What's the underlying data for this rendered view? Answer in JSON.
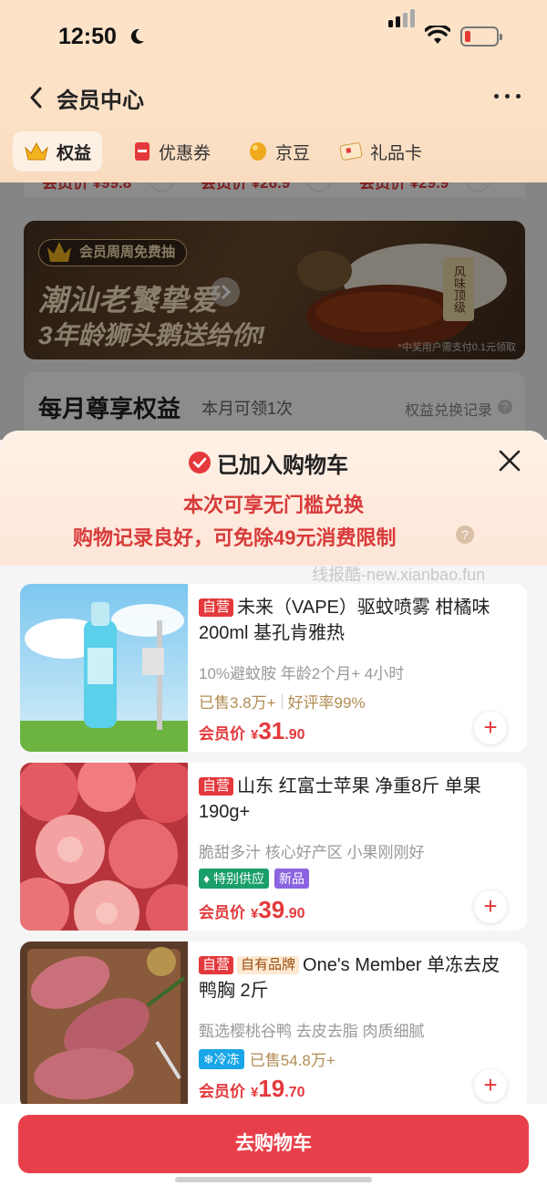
{
  "status": {
    "time": "12:50"
  },
  "nav": {
    "title": "会员中心"
  },
  "tabs": [
    {
      "label": "权益",
      "icon": "crown-icon",
      "active": true
    },
    {
      "label": "优惠券",
      "icon": "coupon-icon",
      "active": false
    },
    {
      "label": "京豆",
      "icon": "bean-icon",
      "active": false
    },
    {
      "label": "礼品卡",
      "icon": "gift-card-icon",
      "active": false
    }
  ],
  "background": {
    "strip_prices": [
      "会员价 ¥99.8",
      "会员价 ¥26.9",
      "会员价 ¥29.9"
    ],
    "banner": {
      "tag": "会员周周免费抽",
      "line1": "潮汕老饕挚爱",
      "line2": "3年龄狮头鹅送给你!",
      "stamp": "风味顶级",
      "note": "*中奖用户需支付0.1元领取"
    },
    "benefits": {
      "title": "每月尊享权益",
      "subtitle": "本月可领1次",
      "link": "权益兑换记录"
    }
  },
  "sheet": {
    "title": "已加入购物车",
    "line1": "本次可享无门槛兑换",
    "line2": "购物记录良好，可免除49元消费限制",
    "watermark": "线报酷-new.xianbao.fun"
  },
  "products": [
    {
      "badges": [
        "自营"
      ],
      "title": "未来（VAPE）驱蚊喷雾 柑橘味 200ml 基孔肯雅热",
      "subtitle": "10%避蚊胺 年龄2个月+ 4小时",
      "sold": "已售3.8万+",
      "rating": "好评率99%",
      "price_label": "会员价",
      "currency": "¥",
      "price_int": "31",
      "price_dec": ".90"
    },
    {
      "badges": [
        "自营"
      ],
      "title": "山东 红富士苹果 净重8斤 单果190g+",
      "subtitle": "脆甜多汁 核心好产区 小果刚刚好",
      "tags": [
        "特别供应",
        "新品"
      ],
      "price_label": "会员价",
      "currency": "¥",
      "price_int": "39",
      "price_dec": ".90"
    },
    {
      "badges": [
        "自营",
        "自有品牌"
      ],
      "title": "One's Member 单冻去皮鸭胸 2斤",
      "subtitle": "甄选樱桃谷鸭 去皮去脂 肉质细腻",
      "tag": "冷冻",
      "sold": "已售54.8万+",
      "price_label": "会员价",
      "currency": "¥",
      "price_int": "19",
      "price_dec": ".70"
    }
  ],
  "bottom": {
    "cart_button": "去购物车"
  },
  "colors": {
    "accent": "#e4393c",
    "button": "#e8404b",
    "header": "#fce3c8"
  }
}
